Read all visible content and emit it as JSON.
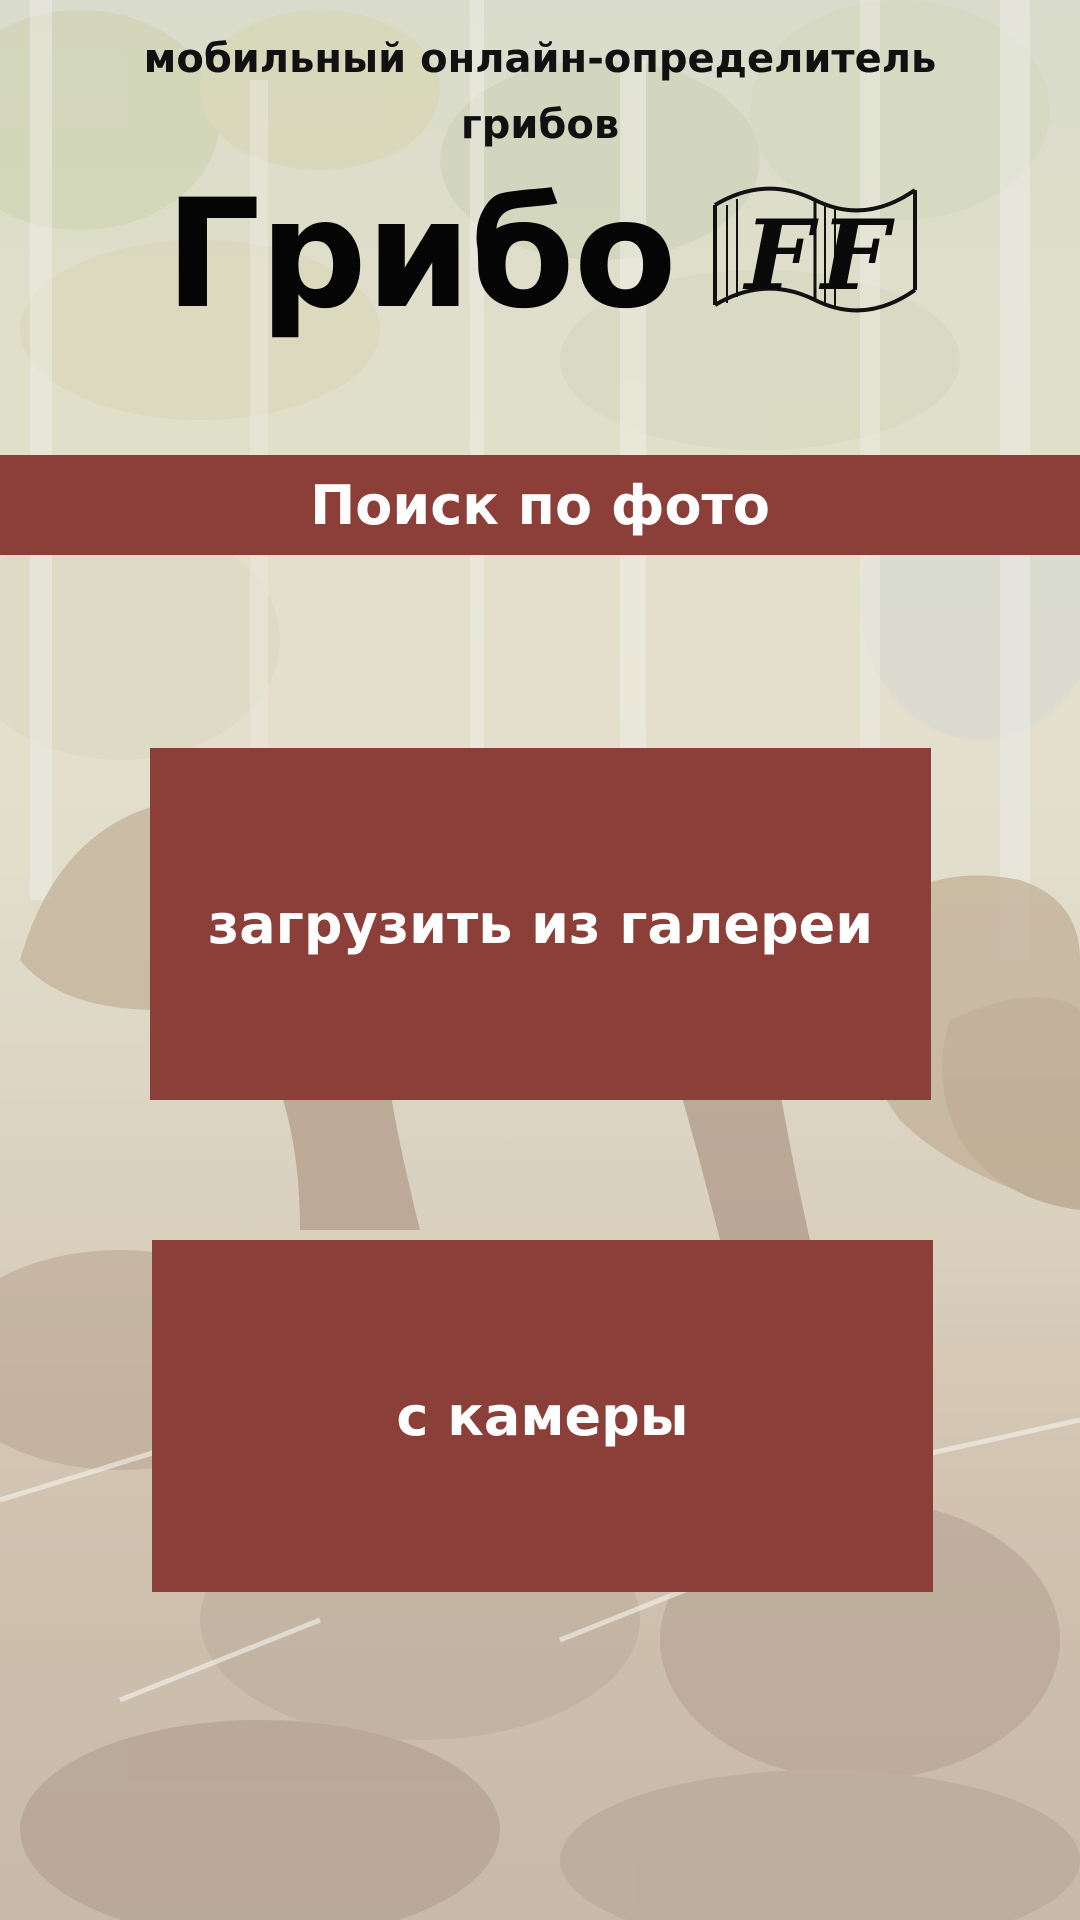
{
  "header": {
    "subtitle": "мобильный онлайн-определитель грибов",
    "logo_word": "Грибо",
    "logo_suffix": "FF"
  },
  "banner": {
    "title": "Поиск по фото"
  },
  "actions": {
    "gallery_label": "загрузить из галереи",
    "camera_label": "с камеры"
  },
  "colors": {
    "accent": "#8b3f38",
    "button_text": "#ffffff",
    "heading_text": "#111111"
  },
  "icons": {
    "logo_ribbon": "film-ribbon-icon"
  }
}
